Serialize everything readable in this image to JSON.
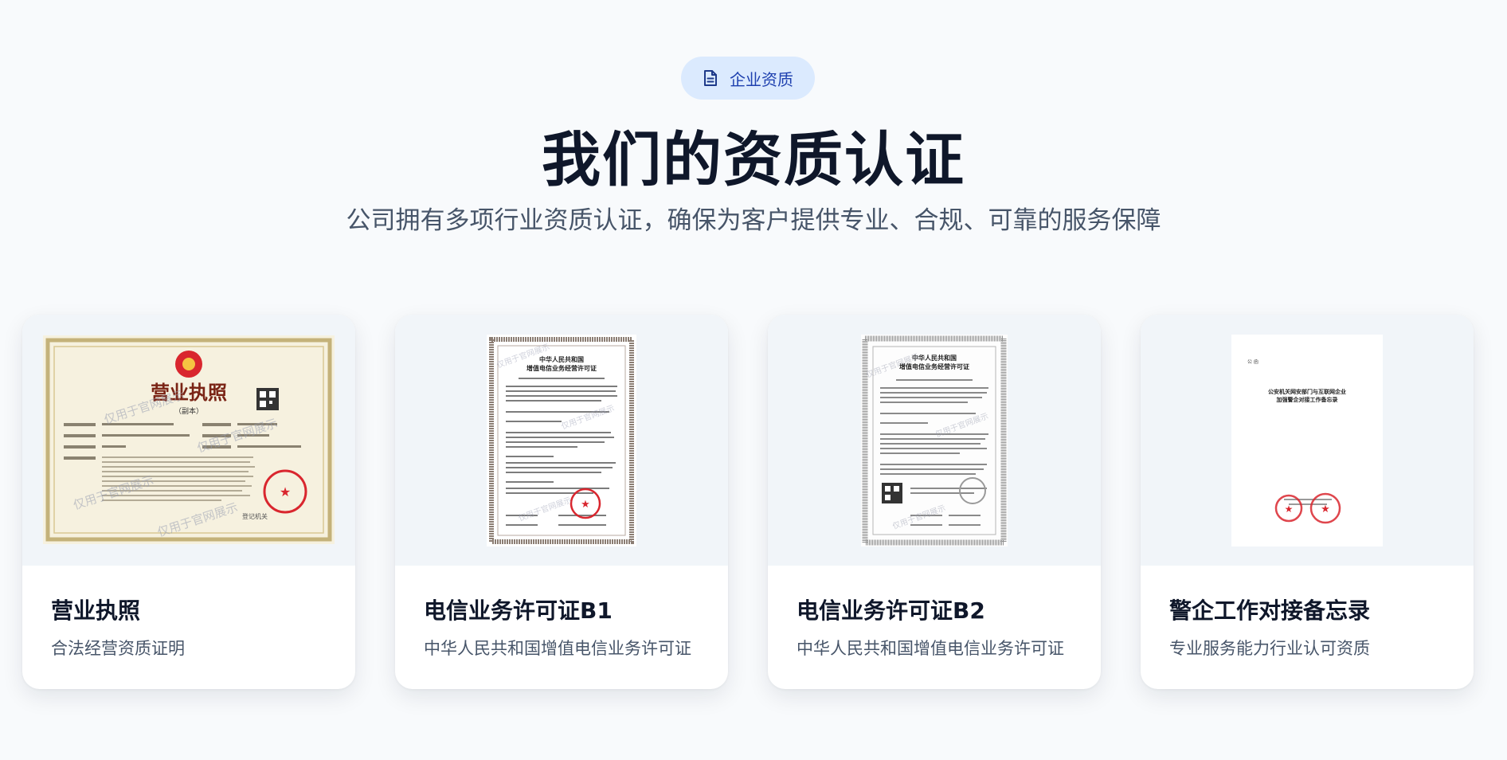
{
  "header": {
    "badge_label": "企业资质",
    "badge_icon": "document-icon",
    "title": "我们的资质认证",
    "subtitle": "公司拥有多项行业资质认证，确保为客户提供专业、合规、可靠的服务保障"
  },
  "certificates": [
    {
      "title": "营业执照",
      "description": "合法经营资质证明",
      "image_text": {
        "heading": "营业执照",
        "subheading": "（副本）",
        "watermark": "仅用于官网展示",
        "authority": "登记机关"
      }
    },
    {
      "title": "电信业务许可证B1",
      "description": "中华人民共和国增值电信业务许可证",
      "image_text": {
        "heading_line1": "中华人民共和国",
        "heading_line2": "增值电信业务经营许可证",
        "watermark": "仅用于官网展示"
      }
    },
    {
      "title": "电信业务许可证B2",
      "description": "中华人民共和国增值电信业务许可证",
      "image_text": {
        "heading_line1": "中华人民共和国",
        "heading_line2": "增值电信业务经营许可证",
        "watermark": "仅用于官网展示"
      }
    },
    {
      "title": "警企工作对接备忘录",
      "description": "专业服务能力行业认可资质",
      "image_text": {
        "salutation": "公 函",
        "heading_line1": "公安机关网安部门与互联网企业",
        "heading_line2": "加强警企对接工作备忘录"
      }
    }
  ],
  "colors": {
    "page_background": "#f8fafc",
    "badge_background": "#dbeafe",
    "badge_text": "#1e40af",
    "title": "#0f172a",
    "subtitle": "#475569",
    "stamp_red": "#d9262e"
  }
}
